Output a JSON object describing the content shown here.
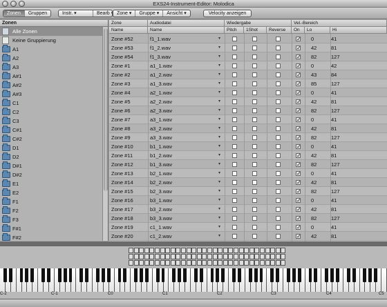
{
  "window": {
    "title": "EXS24-Instrument-Editor: Molodica"
  },
  "toolbar": {
    "view_segments": [
      {
        "label": "Zonen",
        "active": true
      },
      {
        "label": "Gruppen",
        "active": false
      }
    ],
    "menu_segments": [
      {
        "label": "Instr."
      },
      {
        "label": "Bearb"
      }
    ],
    "menu_segments_2": [
      {
        "label": "Zone"
      },
      {
        "label": "Gruppe"
      },
      {
        "label": "Ansicht"
      }
    ],
    "velocity_button": "Velocity anzeigen"
  },
  "left_panel": {
    "title": "Zonen",
    "items": [
      {
        "label": "Alle Zonen",
        "icon": "all-zones-icon",
        "selected": true
      },
      {
        "label": "Keine Gruppierung",
        "icon": "document-icon"
      },
      {
        "label": "A1",
        "icon": "folder-icon"
      },
      {
        "label": "A2",
        "icon": "folder-icon"
      },
      {
        "label": "A3",
        "icon": "folder-icon"
      },
      {
        "label": "A#1",
        "icon": "folder-icon"
      },
      {
        "label": "A#2",
        "icon": "folder-icon"
      },
      {
        "label": "A#3",
        "icon": "folder-icon"
      },
      {
        "label": "C1",
        "icon": "folder-icon"
      },
      {
        "label": "C2",
        "icon": "folder-icon"
      },
      {
        "label": "C3",
        "icon": "folder-icon"
      },
      {
        "label": "C#1",
        "icon": "folder-icon"
      },
      {
        "label": "C#2",
        "icon": "folder-icon"
      },
      {
        "label": "D1",
        "icon": "folder-icon"
      },
      {
        "label": "D2",
        "icon": "folder-icon"
      },
      {
        "label": "D#1",
        "icon": "folder-icon"
      },
      {
        "label": "D#2",
        "icon": "folder-icon"
      },
      {
        "label": "E1",
        "icon": "folder-icon"
      },
      {
        "label": "E2",
        "icon": "folder-icon"
      },
      {
        "label": "F1",
        "icon": "folder-icon"
      },
      {
        "label": "F2",
        "icon": "folder-icon"
      },
      {
        "label": "F3",
        "icon": "folder-icon"
      },
      {
        "label": "F#1",
        "icon": "folder-icon"
      },
      {
        "label": "F#2",
        "icon": "folder-icon"
      }
    ]
  },
  "table": {
    "group_headers": {
      "zone": "Zone",
      "audio": "Audiodatei",
      "playback": "Wiedergabe",
      "vel": "Vel.-Bereich"
    },
    "columns": {
      "name1": "Name",
      "name2": "Name",
      "pitch": "Pitch",
      "oneshot": "1Shot",
      "reverse": "Reverse",
      "on": "On",
      "lo": "Lo",
      "hi": "Hi"
    },
    "rows": [
      {
        "zone": "Zone #52",
        "file": "f1_1.wav",
        "lo": "0",
        "hi": "41"
      },
      {
        "zone": "Zone #53",
        "file": "f1_2.wav",
        "lo": "42",
        "hi": "81"
      },
      {
        "zone": "Zone #54",
        "file": "f1_3.wav",
        "lo": "82",
        "hi": "127"
      },
      {
        "zone": "Zone #1",
        "file": "a1_1.wav",
        "lo": "0",
        "hi": "42"
      },
      {
        "zone": "Zone #2",
        "file": "a1_2.wav",
        "lo": "43",
        "hi": "84"
      },
      {
        "zone": "Zone #3",
        "file": "a1_3.wav",
        "lo": "85",
        "hi": "127"
      },
      {
        "zone": "Zone #4",
        "file": "a2_1.wav",
        "lo": "0",
        "hi": "41"
      },
      {
        "zone": "Zone #5",
        "file": "a2_2.wav",
        "lo": "42",
        "hi": "81"
      },
      {
        "zone": "Zone #6",
        "file": "a2_3.wav",
        "lo": "82",
        "hi": "127"
      },
      {
        "zone": "Zone #7",
        "file": "a3_1.wav",
        "lo": "0",
        "hi": "41"
      },
      {
        "zone": "Zone #8",
        "file": "a3_2.wav",
        "lo": "42",
        "hi": "81"
      },
      {
        "zone": "Zone #9",
        "file": "a3_3.wav",
        "lo": "82",
        "hi": "127"
      },
      {
        "zone": "Zone #10",
        "file": "b1_1.wav",
        "lo": "0",
        "hi": "41"
      },
      {
        "zone": "Zone #11",
        "file": "b1_2.wav",
        "lo": "42",
        "hi": "81"
      },
      {
        "zone": "Zone #12",
        "file": "b1_3.wav",
        "lo": "82",
        "hi": "127"
      },
      {
        "zone": "Zone #13",
        "file": "b2_1.wav",
        "lo": "0",
        "hi": "41"
      },
      {
        "zone": "Zone #14",
        "file": "b2_2.wav",
        "lo": "42",
        "hi": "81"
      },
      {
        "zone": "Zone #15",
        "file": "b2_3.wav",
        "lo": "82",
        "hi": "127"
      },
      {
        "zone": "Zone #16",
        "file": "b3_1.wav",
        "lo": "0",
        "hi": "41"
      },
      {
        "zone": "Zone #17",
        "file": "b3_2.wav",
        "lo": "42",
        "hi": "81"
      },
      {
        "zone": "Zone #18",
        "file": "b3_3.wav",
        "lo": "82",
        "hi": "127"
      },
      {
        "zone": "Zone #19",
        "file": "c1_1.wav",
        "lo": "0",
        "hi": "41"
      },
      {
        "zone": "Zone #20",
        "file": "c1_2.wav",
        "lo": "42",
        "hi": "81"
      },
      {
        "zone": "Zone #21",
        "file": "c1_3.wav",
        "lo": "82",
        "hi": "127"
      },
      {
        "zone": "Zone #22",
        "file": "c2_1.wav",
        "lo": "0",
        "hi": "41"
      }
    ]
  },
  "keyboard": {
    "octave_labels": [
      "C-2",
      "C-1",
      "C0",
      "C1",
      "C2",
      "C3",
      "C4",
      "C5"
    ]
  },
  "colors": {
    "selection": "#8f8f8f",
    "folder": "#5a88b5"
  }
}
